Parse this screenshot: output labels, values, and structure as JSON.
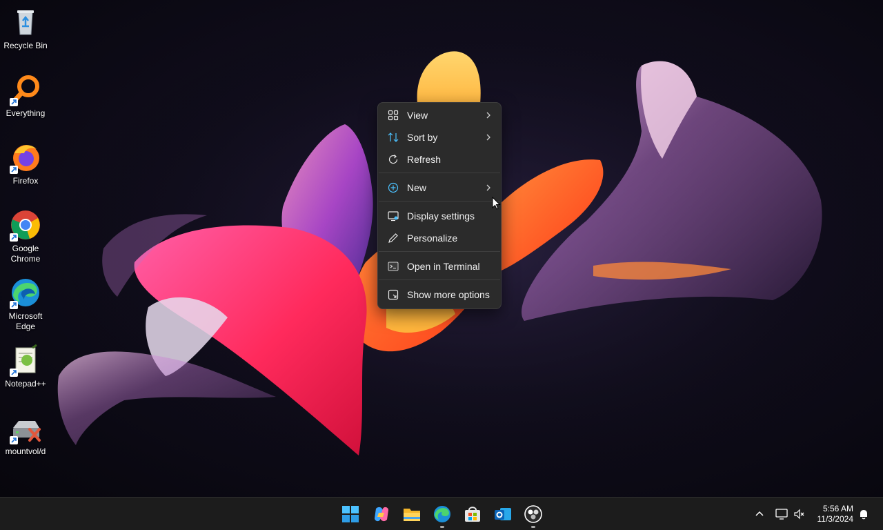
{
  "desktop_icons": [
    {
      "label": "Recycle Bin",
      "icon": "recycle-bin-icon"
    },
    {
      "label": "Everything",
      "icon": "everything-search-icon"
    },
    {
      "label": "Firefox",
      "icon": "firefox-icon"
    },
    {
      "label": "Google Chrome",
      "icon": "chrome-icon"
    },
    {
      "label": "Microsoft Edge",
      "icon": "edge-icon"
    },
    {
      "label": "Notepad++",
      "icon": "notepadpp-icon"
    },
    {
      "label": "mountvol/d",
      "icon": "drive-x-icon"
    }
  ],
  "context_menu": {
    "items": [
      {
        "label": "View",
        "icon": "grid-icon",
        "submenu": true
      },
      {
        "label": "Sort by",
        "icon": "sort-icon",
        "submenu": true
      },
      {
        "label": "Refresh",
        "icon": "refresh-icon",
        "submenu": false
      },
      {
        "label": "New",
        "icon": "plus-circle-icon",
        "submenu": true
      },
      {
        "label": "Display settings",
        "icon": "display-settings-icon",
        "submenu": false
      },
      {
        "label": "Personalize",
        "icon": "pen-icon",
        "submenu": false
      },
      {
        "label": "Open in Terminal",
        "icon": "terminal-icon",
        "submenu": false
      },
      {
        "label": "Show more options",
        "icon": "more-options-icon",
        "submenu": false
      }
    ]
  },
  "taskbar": {
    "apps": [
      "start-icon",
      "copilot-icon",
      "file-explorer-icon",
      "edge-icon",
      "store-icon",
      "outlook-icon",
      "obs-icon"
    ],
    "clock": {
      "time": "5:56 AM",
      "date": "11/3/2024"
    },
    "tray_icons": [
      "chevron-up-icon",
      "network-icon",
      "volume-muted-icon",
      "bell-icon"
    ]
  },
  "colors": {
    "menu_bg": "#2b2b2b",
    "taskbar_bg": "#1c1c1c",
    "accent": "#4cc2ff"
  }
}
